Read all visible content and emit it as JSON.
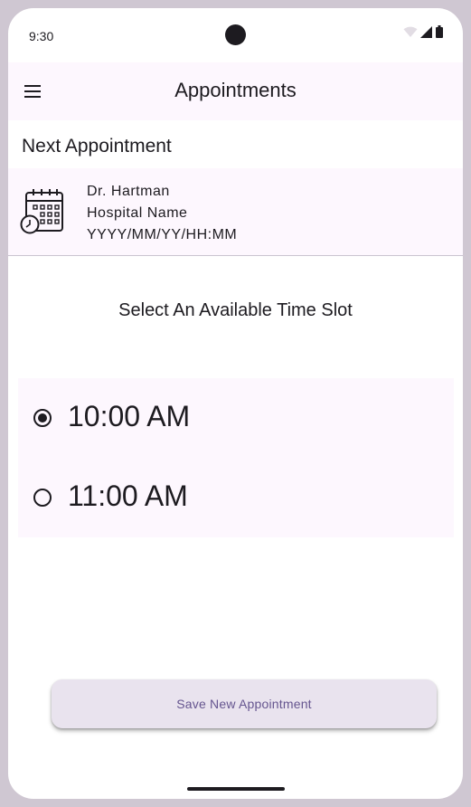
{
  "status_bar": {
    "time": "9:30",
    "icons": [
      "wifi-icon",
      "cellular-signal-icon",
      "battery-icon"
    ]
  },
  "app_bar": {
    "title": "Appointments",
    "menu_icon": "hamburger-menu-icon"
  },
  "next_appointment": {
    "heading": "Next Appointment",
    "icon": "calendar-clock-icon",
    "doctor": "Dr. Hartman",
    "hospital": "Hospital Name",
    "datetime": "YYYY/MM/YY/HH:MM"
  },
  "time_slots": {
    "heading": "Select An Available Time Slot",
    "options": [
      {
        "label": "10:00 AM",
        "selected": true
      },
      {
        "label": "11:00 AM",
        "selected": false
      }
    ]
  },
  "actions": {
    "save_label": "Save New Appointment"
  },
  "colors": {
    "surface": "#fdf7fe",
    "on_surface": "#1d1b20",
    "button_container": "#e9e3ee",
    "button_text": "#65558f"
  }
}
